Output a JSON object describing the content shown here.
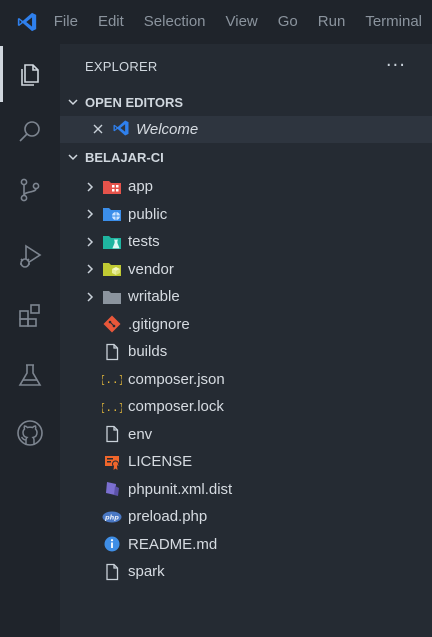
{
  "menu": [
    "File",
    "Edit",
    "Selection",
    "View",
    "Go",
    "Run",
    "Terminal"
  ],
  "activity": [
    "explorer-icon",
    "search-icon",
    "source-control-icon",
    "run-debug-icon",
    "extensions-icon",
    "testing-icon",
    "github-icon"
  ],
  "sidebar": {
    "title": "EXPLORER",
    "more": "···",
    "open_editors": {
      "label": "OPEN EDITORS",
      "items": [
        {
          "name": "Welcome",
          "icon": "vscode-icon"
        }
      ]
    },
    "project": {
      "label": "BELAJAR-CI",
      "folders": [
        {
          "name": "app",
          "icon": "folder-app-icon",
          "color": "#e5534b"
        },
        {
          "name": "public",
          "icon": "folder-public-icon",
          "color": "#3b8eea"
        },
        {
          "name": "tests",
          "icon": "folder-tests-icon",
          "color": "#1fb5a0"
        },
        {
          "name": "vendor",
          "icon": "folder-vendor-icon",
          "color": "#c0ca33"
        },
        {
          "name": "writable",
          "icon": "folder-icon",
          "color": "#8b949e"
        }
      ],
      "files": [
        {
          "name": ".gitignore",
          "icon": "git-icon"
        },
        {
          "name": "builds",
          "icon": "file-icon"
        },
        {
          "name": "composer.json",
          "icon": "json-icon"
        },
        {
          "name": "composer.lock",
          "icon": "json-icon"
        },
        {
          "name": "env",
          "icon": "file-icon"
        },
        {
          "name": "LICENSE",
          "icon": "license-icon"
        },
        {
          "name": "phpunit.xml.dist",
          "icon": "phpunit-icon"
        },
        {
          "name": "preload.php",
          "icon": "php-icon"
        },
        {
          "name": "README.md",
          "icon": "info-icon"
        },
        {
          "name": "spark",
          "icon": "file-icon"
        }
      ]
    }
  },
  "colors": {
    "accent": "#2f80ed",
    "json": "#e5b93b",
    "git": "#e8573a",
    "license": "#f0662b",
    "phpunit": "#7b6fd0",
    "php": "#4a78c4",
    "info": "#3f8ee6"
  }
}
